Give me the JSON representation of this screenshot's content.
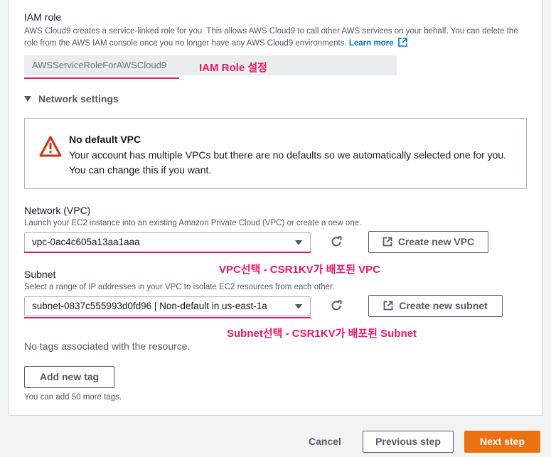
{
  "iam": {
    "title": "IAM role",
    "desc_text": "AWS Cloud9 creates a service-linked role for you. This allows AWS Cloud9 to call other AWS services on your behalf. You can delete the role from the AWS IAM console once you no longer have any AWS Cloud9 environments.",
    "learn_more": "Learn more",
    "role_value": "AWSServiceRoleForAWSCloud9",
    "annotation": "IAM Role 설정"
  },
  "network_section": {
    "title": "Network settings"
  },
  "alert": {
    "title": "No default VPC",
    "message": "Your account has multiple VPCs but there are no defaults so we automatically selected one for you. You can change this if you want."
  },
  "vpc": {
    "label": "Network (VPC)",
    "desc": "Launch your EC2 instance into an existing Amazon Private Cloud (VPC) or create a new one.",
    "selected": "vpc-0ac4c605a13aa1aaa",
    "create_label": "Create new VPC",
    "annotation": "VPC선택 - CSR1KV가 배포된 VPC"
  },
  "subnet": {
    "label": "Subnet",
    "desc": "Select a range of IP addresses in your VPC to isolate EC2 resources from each other.",
    "selected": "subnet-0837c555993d0fd96 | Non-default in us-east-1a",
    "create_label": "Create new subnet",
    "annotation": "Subnet선택 - CSR1KV가 배포된 Subnet"
  },
  "tags": {
    "empty_text": "No tags associated with the resource.",
    "add_label": "Add new tag",
    "hint": "You can add 50 more tags."
  },
  "footer": {
    "cancel": "Cancel",
    "previous": "Previous step",
    "next": "Next step"
  },
  "colors": {
    "accent": "#ec7211",
    "annotation": "#e6176c",
    "link": "#0073bb",
    "warning": "#d13212"
  }
}
